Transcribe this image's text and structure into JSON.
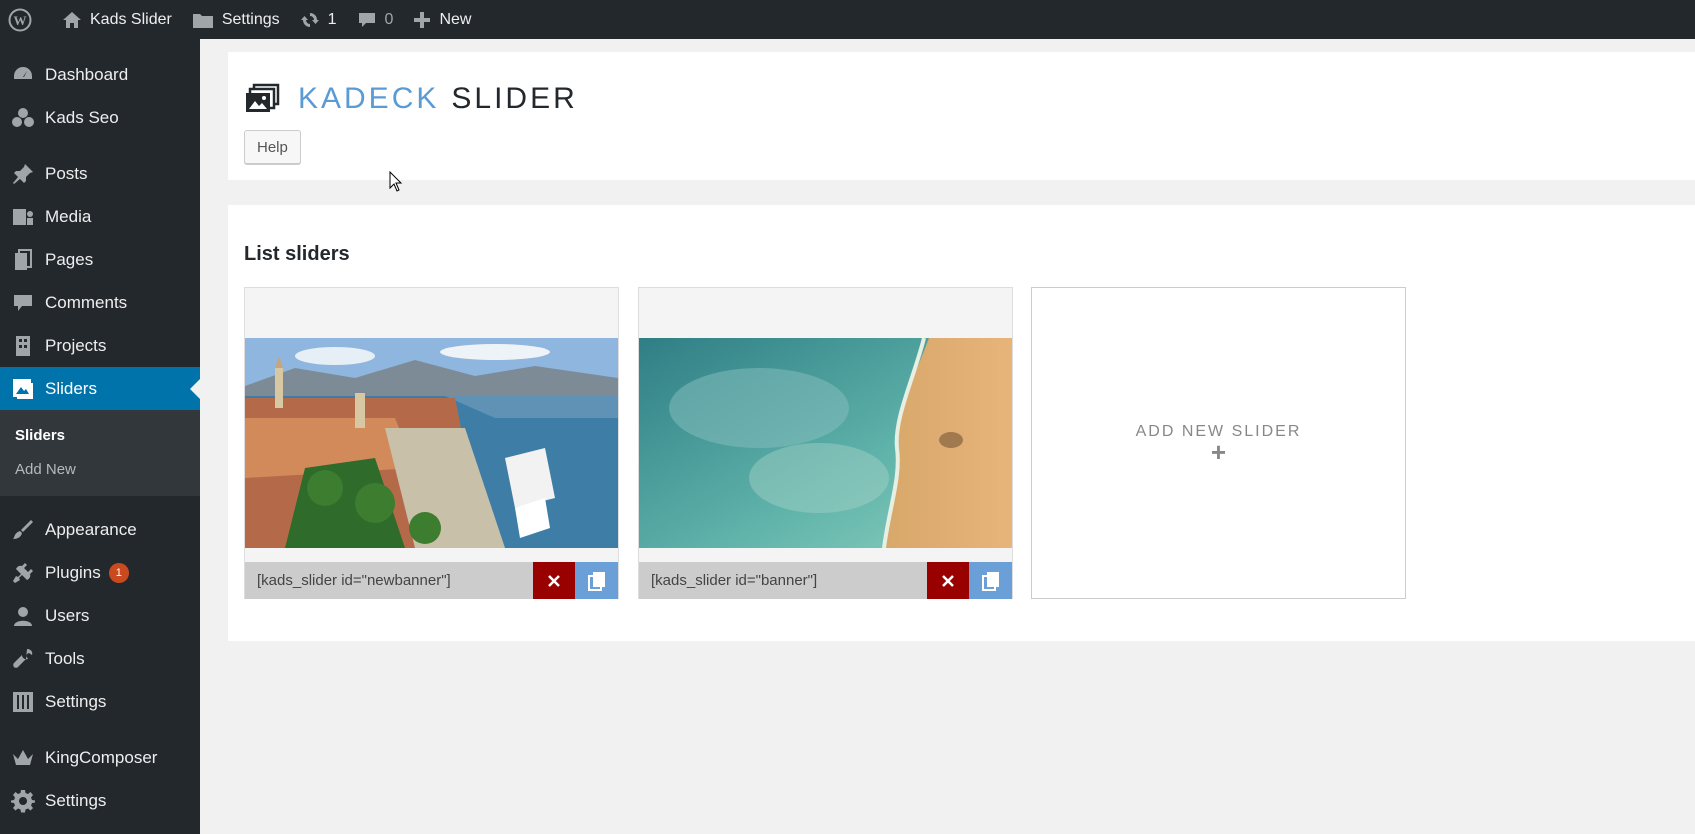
{
  "admin_bar": {
    "site_name": "Kads Slider",
    "settings_label": "Settings",
    "updates_count": "1",
    "comments_count": "0",
    "new_label": "New"
  },
  "sidebar": {
    "items": [
      {
        "label": "Dashboard",
        "icon": "dashboard-icon"
      },
      {
        "label": "Kads Seo",
        "icon": "seo-icon"
      },
      {
        "label": "Posts",
        "icon": "pushpin-icon"
      },
      {
        "label": "Media",
        "icon": "media-icon"
      },
      {
        "label": "Pages",
        "icon": "pages-icon"
      },
      {
        "label": "Comments",
        "icon": "comment-icon"
      },
      {
        "label": "Projects",
        "icon": "building-icon"
      },
      {
        "label": "Sliders",
        "icon": "slider-icon"
      },
      {
        "label": "Appearance",
        "icon": "paintbrush-icon"
      },
      {
        "label": "Plugins",
        "icon": "plug-icon"
      },
      {
        "label": "Users",
        "icon": "user-icon"
      },
      {
        "label": "Tools",
        "icon": "wrench-icon"
      },
      {
        "label": "Settings",
        "icon": "sliders-settings-icon"
      },
      {
        "label": "KingComposer",
        "icon": "crown-icon"
      },
      {
        "label": "Settings",
        "icon": "gear-icon"
      }
    ],
    "submenu": [
      {
        "label": "Sliders"
      },
      {
        "label": "Add New"
      }
    ],
    "plugins_badge": "1",
    "current_color": "#0073aa"
  },
  "header": {
    "brand_light": "KADECK",
    "brand_dark": "SLIDER",
    "help_label": "Help"
  },
  "list": {
    "title": "List sliders",
    "sliders": [
      {
        "shortcode": "[kads_slider id=\"newbanner\"]",
        "image": "harbor-town-photo"
      },
      {
        "shortcode": "[kads_slider id=\"banner\"]",
        "image": "beach-aerial-photo"
      }
    ],
    "add_new_label": "ADD NEW SLIDER",
    "add_new_plus": "+"
  },
  "colors": {
    "delete": "#990000",
    "copy": "#6a9fd8",
    "brand": "#5b9bd5"
  }
}
